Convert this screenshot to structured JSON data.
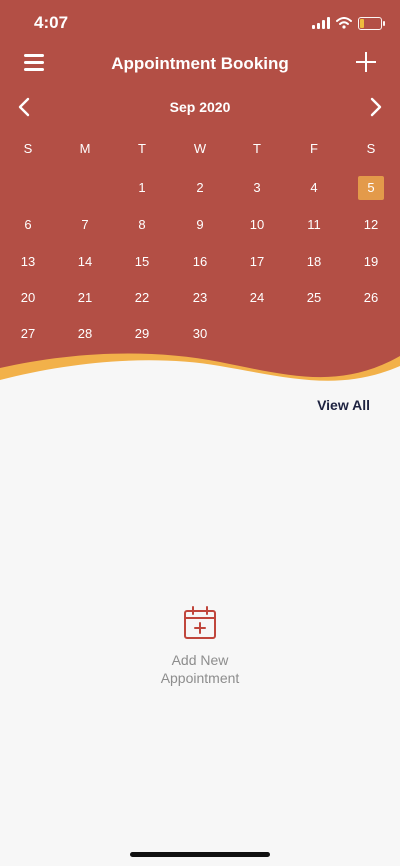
{
  "status": {
    "time": "4:07"
  },
  "nav": {
    "title": "Appointment Booking"
  },
  "calendar": {
    "month_label": "Sep 2020",
    "weekdays": [
      "S",
      "M",
      "T",
      "W",
      "T",
      "F",
      "S"
    ],
    "weeks": [
      [
        "",
        "",
        "1",
        "2",
        "3",
        "4",
        "5"
      ],
      [
        "6",
        "7",
        "8",
        "9",
        "10",
        "11",
        "12"
      ],
      [
        "13",
        "14",
        "15",
        "16",
        "17",
        "18",
        "19"
      ],
      [
        "20",
        "21",
        "22",
        "23",
        "24",
        "25",
        "26"
      ],
      [
        "27",
        "28",
        "29",
        "30",
        "",
        "",
        ""
      ]
    ],
    "selected_day": "5"
  },
  "list": {
    "view_all_label": "View All"
  },
  "empty_state": {
    "line1": "Add New",
    "line2": "Appointment"
  },
  "colors": {
    "header": "#b34f45",
    "accent": "#e39a4a",
    "background": "#f7f7f7"
  },
  "icons": [
    "menu-icon",
    "plus-icon",
    "chevron-left-icon",
    "chevron-right-icon",
    "calendar-add-icon",
    "wifi-icon",
    "battery-icon",
    "signal-icon"
  ]
}
